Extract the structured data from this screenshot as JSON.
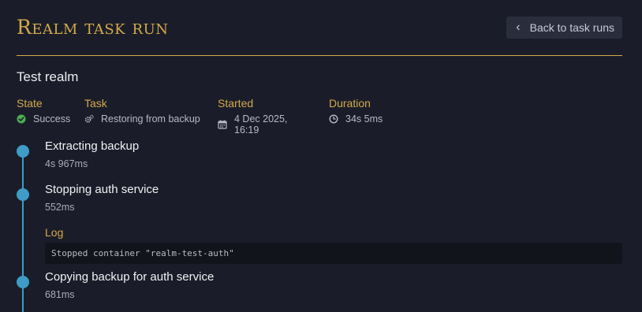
{
  "header": {
    "title": "Realm task run",
    "back_label": "Back to task runs"
  },
  "realm": {
    "name": "Test realm"
  },
  "meta": {
    "state": {
      "label": "State",
      "value": "Success",
      "icon": "check-circle-icon",
      "color": "#4caf50"
    },
    "task": {
      "label": "Task",
      "value": "Restoring from backup",
      "icon": "gears-icon"
    },
    "started": {
      "label": "Started",
      "value": "4 Dec 2025, 16:19",
      "icon": "calendar-icon"
    },
    "duration": {
      "label": "Duration",
      "value": "34s 5ms",
      "icon": "clock-icon"
    }
  },
  "steps": [
    {
      "name": "Extracting backup",
      "duration": "4s 967ms"
    },
    {
      "name": "Stopping auth service",
      "duration": "552ms",
      "log_label": "Log",
      "log": "Stopped container \"realm-test-auth\""
    },
    {
      "name": "Copying backup for auth service",
      "duration": "681ms"
    }
  ],
  "colors": {
    "accent": "#d4a94a",
    "timeline": "#3e9cc7",
    "background": "#1a1d29"
  }
}
